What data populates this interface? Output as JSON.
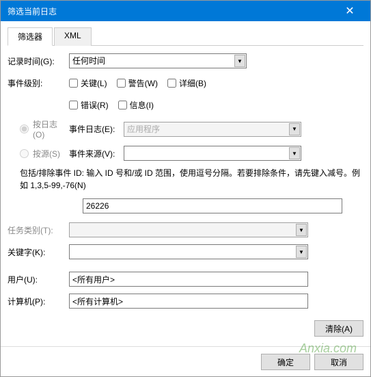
{
  "window": {
    "title": "筛选当前日志",
    "close": "✕"
  },
  "tabs": {
    "filter": "筛选器",
    "xml": "XML"
  },
  "labels": {
    "logged_time": "记录时间(G):",
    "event_level": "事件级别:",
    "by_log": "按日志(O)",
    "by_source": "按源(S)",
    "event_log": "事件日志(E):",
    "event_source": "事件来源(V):",
    "task_category": "任务类别(T):",
    "keywords": "关键字(K):",
    "user": "用户(U):",
    "computer": "计算机(P):"
  },
  "values": {
    "logged_time": "任何时间",
    "event_log": "应用程序",
    "event_id": "26226",
    "user": "<所有用户>",
    "computer": "<所有计算机>"
  },
  "checkboxes": {
    "critical": "关键(L)",
    "warning": "警告(W)",
    "verbose": "详细(B)",
    "error": "错误(R)",
    "information": "信息(I)"
  },
  "help_text": "包括/排除事件 ID: 输入 ID 号和/或 ID 范围，使用逗号分隔。若要排除条件，请先键入减号。例如 1,3,5-99,-76(N)",
  "buttons": {
    "clear": "清除(A)",
    "ok": "确定",
    "cancel": "取消"
  },
  "watermark": "Anxia.com"
}
